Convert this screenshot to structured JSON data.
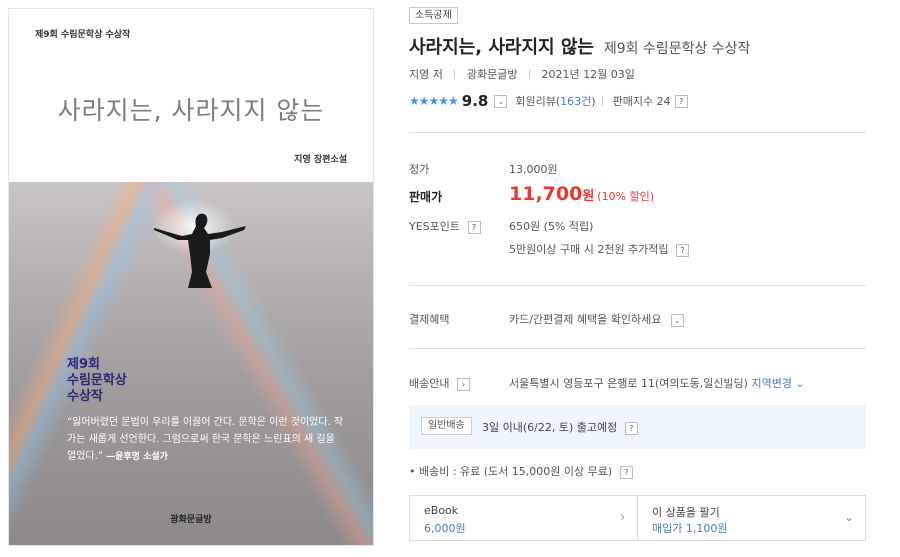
{
  "cover": {
    "series": "제9회 수림문학상 수상작",
    "title": "사라지는, 사라지지 않는",
    "author": "지영 장편소설",
    "award_line1": "제9회",
    "award_line2": "수림문학상",
    "award_line3": "수상작",
    "quote": "“잃어버렸던 문법이 우리를 이끌어 간다. 문학은 이런 것이었다. 작가는 새롭게 선언한다. 그럼으로써 한국 문학은 느린표의 새 길을 열었다.”",
    "quote_by": "—윤후명 소설가",
    "publisher": "광화문글방"
  },
  "tag": "소득공제",
  "title": {
    "main": "사라지는, 사라지지 않는",
    "sub": "제9회 수림문학상 수상작"
  },
  "meta": {
    "author": "지영 저",
    "publisher": "광화문글방",
    "date": "2021년 12월 03일"
  },
  "rating": {
    "stars": "★★★★★",
    "score": "9.8",
    "review_label": "회원리뷰(",
    "review_count": "163건",
    "review_close": ")",
    "sales": "판매지수 24"
  },
  "price": {
    "list_label": "정가",
    "list_value": "13,000원",
    "sale_label": "판매가",
    "sale_value": "11,700",
    "sale_unit": "원",
    "discount": "(10% 할인)",
    "point_label": "YES포인트",
    "point_value": "650원 (5% 적립)",
    "extra_point": "5만원이상 구매 시 2천원 추가적립"
  },
  "benefit": {
    "label": "결제혜택",
    "value": "카드/간편결제 혜택을 확인하세요"
  },
  "delivery": {
    "label": "배송안내",
    "address": "서울특별시 영등포구 은행로 11(여의도동,일신빌딩)",
    "region_change": "지역변경",
    "chip": "일반배송",
    "schedule": "3일 이내(6/22, 토) 출고예정",
    "fee": "• 배송비 : 유료 (도서 15,000원 이상 무료)"
  },
  "bottom": {
    "ebook_title": "eBook",
    "ebook_price": "6,000원",
    "sell_title": "이 상품을 팔기",
    "sell_price": "매입가 1,100원"
  },
  "help_glyph": "?",
  "colors": {
    "price_red": "#e8382f",
    "link_blue": "#4a7ab8",
    "star_blue": "#4a90e2",
    "ship_bg": "#eef5fc"
  }
}
